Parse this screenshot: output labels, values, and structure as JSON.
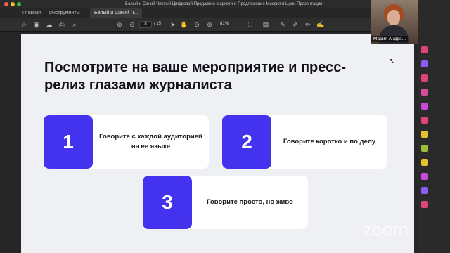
{
  "window": {
    "title": "Белый и Синий Чистый Цифровой Продажи и Маркетинг Предложение Миссия и Цели Презентация"
  },
  "tabs": [
    {
      "label": "Главная"
    },
    {
      "label": "Инструменты"
    },
    {
      "label": "Белый и Синий Ч..."
    }
  ],
  "toolbar": {
    "page_current": "8",
    "page_total": "/ 15",
    "zoom": "81%"
  },
  "slide": {
    "headline": "Посмотрите на ваше мероприятие и пресс-релиз глазами журналиста",
    "cards": [
      {
        "number": "1",
        "text": "Говорите с каждой аудиторией на ее языке"
      },
      {
        "number": "2",
        "text": "Говорите коротко и по делу"
      },
      {
        "number": "3",
        "text": "Говорите просто, но живо"
      }
    ],
    "accent_color": "#4433ee"
  },
  "video": {
    "participant_name": "Мария Андре..."
  },
  "watermark": "zoom"
}
